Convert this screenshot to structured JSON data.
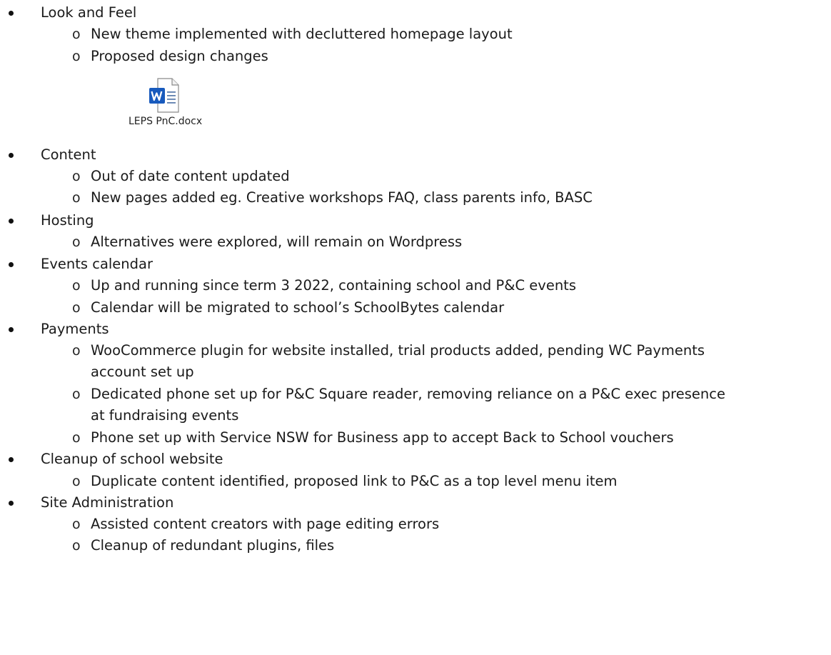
{
  "items": [
    {
      "kind": "l1",
      "text": "Look and Feel"
    },
    {
      "kind": "l2",
      "text": "New theme implemented with decluttered homepage layout"
    },
    {
      "kind": "l2",
      "text": "Proposed design changes"
    },
    {
      "kind": "attach"
    },
    {
      "kind": "l1",
      "text": "Content"
    },
    {
      "kind": "l2",
      "text": "Out of date content updated"
    },
    {
      "kind": "l2",
      "text": "New pages added eg. Creative workshops FAQ, class parents info, BASC"
    },
    {
      "kind": "l1",
      "text": "Hosting"
    },
    {
      "kind": "l2",
      "text": "Alternatives were explored, will remain on Wordpress"
    },
    {
      "kind": "l1",
      "text": "Events calendar"
    },
    {
      "kind": "l2",
      "text": "Up and running since term 3 2022, containing school and P&C events"
    },
    {
      "kind": "l2",
      "text": "Calendar will be migrated to school’s SchoolBytes calendar"
    },
    {
      "kind": "l1",
      "text": "Payments"
    },
    {
      "kind": "l2",
      "text": "WooCommerce plugin for website installed, trial products added, pending WC Payments"
    },
    {
      "kind": "cont",
      "text": "account set up"
    },
    {
      "kind": "l2",
      "text": "Dedicated phone set up for P&C Square reader, removing reliance on a P&C exec presence"
    },
    {
      "kind": "cont",
      "text": "at fundraising events"
    },
    {
      "kind": "l2",
      "text": "Phone set up with Service NSW for Business app to accept Back to School vouchers"
    },
    {
      "kind": "l1",
      "text": "Cleanup of school website"
    },
    {
      "kind": "l2",
      "text": "Duplicate content identified, proposed link to P&C as a top level menu item"
    },
    {
      "kind": "l1",
      "text": "Site Administration"
    },
    {
      "kind": "l2",
      "text": "Assisted content creators with page editing errors"
    },
    {
      "kind": "l2",
      "text": "Cleanup of redundant plugins, files"
    }
  ],
  "attachment": {
    "filename": "LEPS PnC.docx",
    "icon": "word-document-icon"
  },
  "bullet_marker": "o",
  "colors": {
    "word_blue": "#185abd",
    "text": "#1a1a1a"
  }
}
